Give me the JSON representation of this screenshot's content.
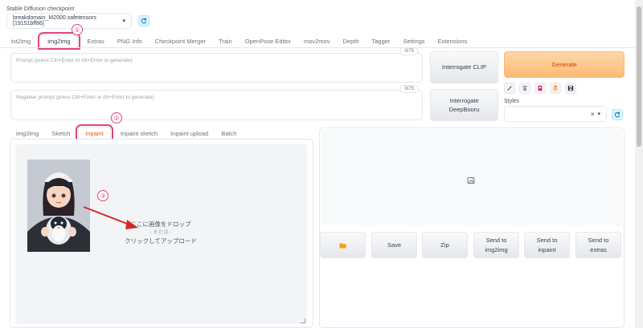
{
  "checkpoint": {
    "label": "Stable Diffusion checkpoint",
    "value": "breakdomain_M2000.safetensors [19151bff86]"
  },
  "main_tabs": [
    {
      "label": "txt2img"
    },
    {
      "label": "img2img"
    },
    {
      "label": "Extras"
    },
    {
      "label": "PNG Info"
    },
    {
      "label": "Checkpoint Merger"
    },
    {
      "label": "Train"
    },
    {
      "label": "OpenPose Editor"
    },
    {
      "label": "mov2mov"
    },
    {
      "label": "Depth"
    },
    {
      "label": "Tagger"
    },
    {
      "label": "Settings"
    },
    {
      "label": "Extensions"
    }
  ],
  "prompt": {
    "placeholder": "Prompt (press Ctrl+Enter or Alt+Enter to generate)",
    "counter": "0/75"
  },
  "negative_prompt": {
    "placeholder": "Negative prompt (press Ctrl+Enter or Alt+Enter to generate)",
    "counter": "0/75"
  },
  "buttons": {
    "interrogate_clip": "Interrogate CLIP",
    "interrogate_deepbooru": "Interrogate DeepBooru",
    "generate": "Generate"
  },
  "styles": {
    "label": "Styles",
    "clear": "×",
    "chevron": "▾"
  },
  "sub_tabs": [
    {
      "label": "img2img"
    },
    {
      "label": "Sketch"
    },
    {
      "label": "Inpaint"
    },
    {
      "label": "Inpaint sketch"
    },
    {
      "label": "Inpaint upload"
    },
    {
      "label": "Batch"
    }
  ],
  "drop_zone": {
    "line1": "ここに画像をドロップ",
    "line2": "- または -",
    "line3": "クリックしてアップロード"
  },
  "annotations": {
    "one": "①",
    "two": "②",
    "three": "③"
  },
  "output_buttons": {
    "save": "Save",
    "zip": "Zip",
    "send_img2img": "Send to img2img",
    "send_inpaint": "Send to inpaint",
    "send_extras": "Send to extras"
  },
  "colors": {
    "highlight": "#e0457b",
    "generate_bg": "#fdba74"
  }
}
